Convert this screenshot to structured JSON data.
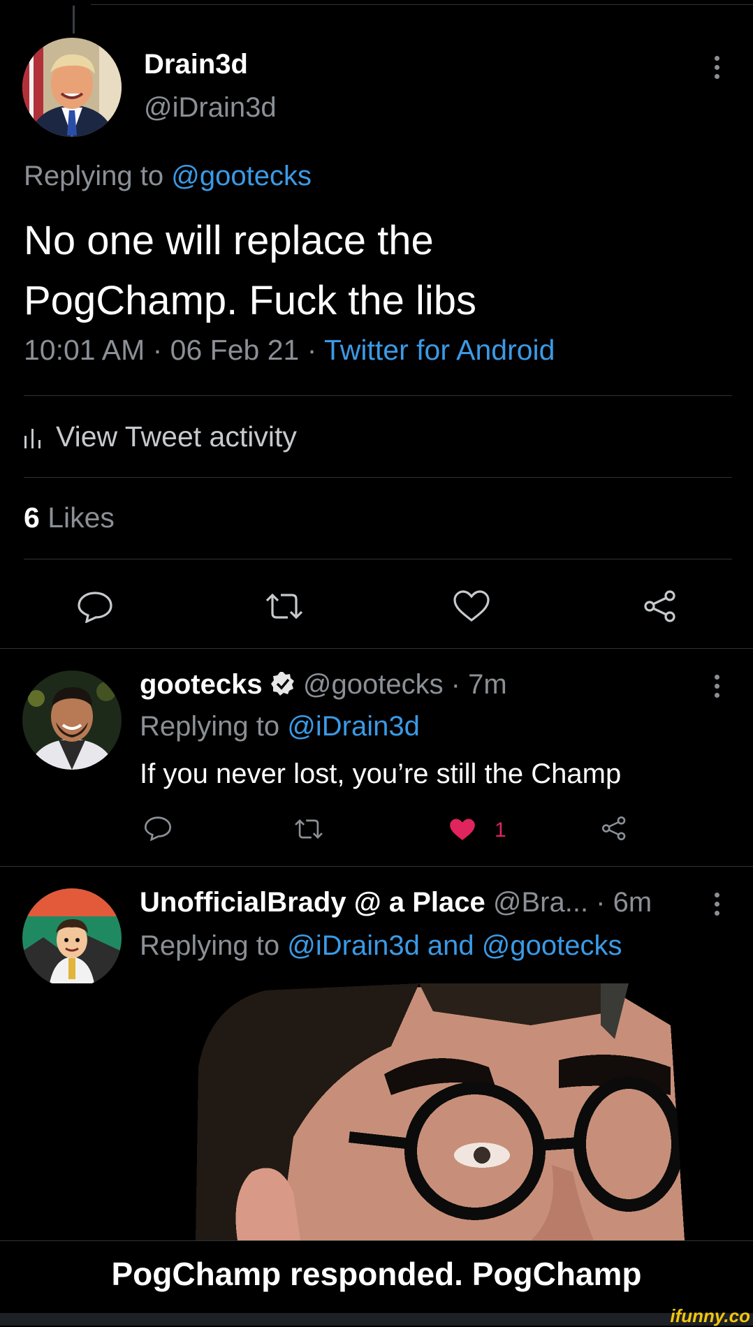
{
  "main_tweet": {
    "display_name": "Drain3d",
    "handle": "@iDrain3d",
    "replying_prefix": "Replying to",
    "replying_to": "@gootecks",
    "text_line1": "No one will replace the",
    "text_line2": "PogChamp. Fuck the libs",
    "timestamp": "10:01 AM · 06 Feb 21 ·",
    "source": "Twitter for Android",
    "activity_label": "View Tweet activity",
    "likes_count": "6",
    "likes_label": "Likes",
    "icons": [
      "reply-icon",
      "retweet-icon",
      "like-icon",
      "share-icon",
      "more-icon",
      "activity-icon"
    ]
  },
  "replies": [
    {
      "display_name": "gootecks",
      "verified": true,
      "meta": "@gootecks · 7m",
      "replying_prefix": "Replying to",
      "replying_to": "@iDrain3d",
      "text": "If you never lost, you’re still the Champ",
      "like_count": "1",
      "liked": true
    },
    {
      "display_name": "UnofficialBrady @ a Place",
      "meta": "@Bra... · 6m",
      "replying_prefix": "Replying to",
      "replying_to": "@iDrain3d and @gootecks"
    }
  ],
  "caption": "PogChamp responded. PogChamp",
  "watermark": "ifunny.co",
  "colors": {
    "background": "#000000",
    "link": "#3b9ae6",
    "muted": "#8b9096",
    "like": "#e0245e",
    "divider": "#2f3336"
  }
}
